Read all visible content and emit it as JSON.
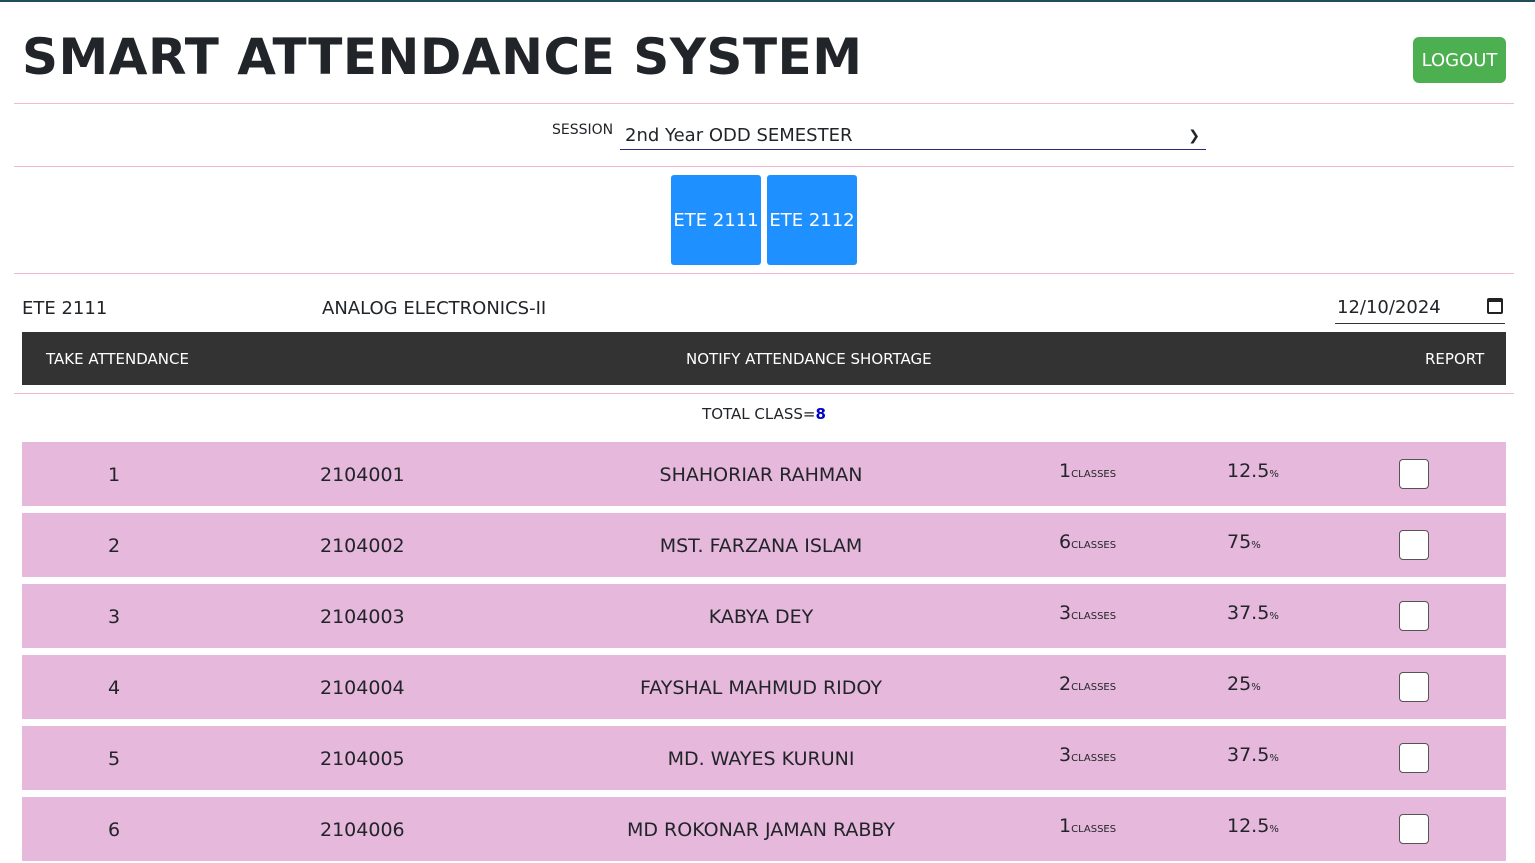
{
  "app": {
    "title": "SMART ATTENDANCE SYSTEM",
    "logout_label": "LOGOUT"
  },
  "session": {
    "label": "SESSION",
    "selected": "2nd Year ODD SEMESTER"
  },
  "courses": [
    {
      "label": "ETE 2111"
    },
    {
      "label": "ETE 2112"
    }
  ],
  "course_info": {
    "code": "ETE 2111",
    "name": "ANALOG ELECTRONICS-II",
    "date": "12/10/2024"
  },
  "actions": {
    "take_attendance": "TAKE ATTENDANCE",
    "notify_shortage": "NOTIFY ATTENDANCE SHORTAGE",
    "report": "REPORT"
  },
  "summary": {
    "total_class_label": "TOTAL CLASS=",
    "total_class_value": "8"
  },
  "units": {
    "classes": "CLASSES",
    "percent": "%"
  },
  "students": [
    {
      "serial": "1",
      "roll": "2104001",
      "name": "SHAHORIAR RAHMAN",
      "classes": "1",
      "percent": "12.5"
    },
    {
      "serial": "2",
      "roll": "2104002",
      "name": "MST. FARZANA ISLAM",
      "classes": "6",
      "percent": "75"
    },
    {
      "serial": "3",
      "roll": "2104003",
      "name": "KABYA DEY",
      "classes": "3",
      "percent": "37.5"
    },
    {
      "serial": "4",
      "roll": "2104004",
      "name": "FAYSHAL MAHMUD RIDOY",
      "classes": "2",
      "percent": "25"
    },
    {
      "serial": "5",
      "roll": "2104005",
      "name": "MD. WAYES KURUNI",
      "classes": "3",
      "percent": "37.5"
    },
    {
      "serial": "6",
      "roll": "2104006",
      "name": "MD ROKONAR JAMAN RABBY",
      "classes": "1",
      "percent": "12.5"
    }
  ]
}
